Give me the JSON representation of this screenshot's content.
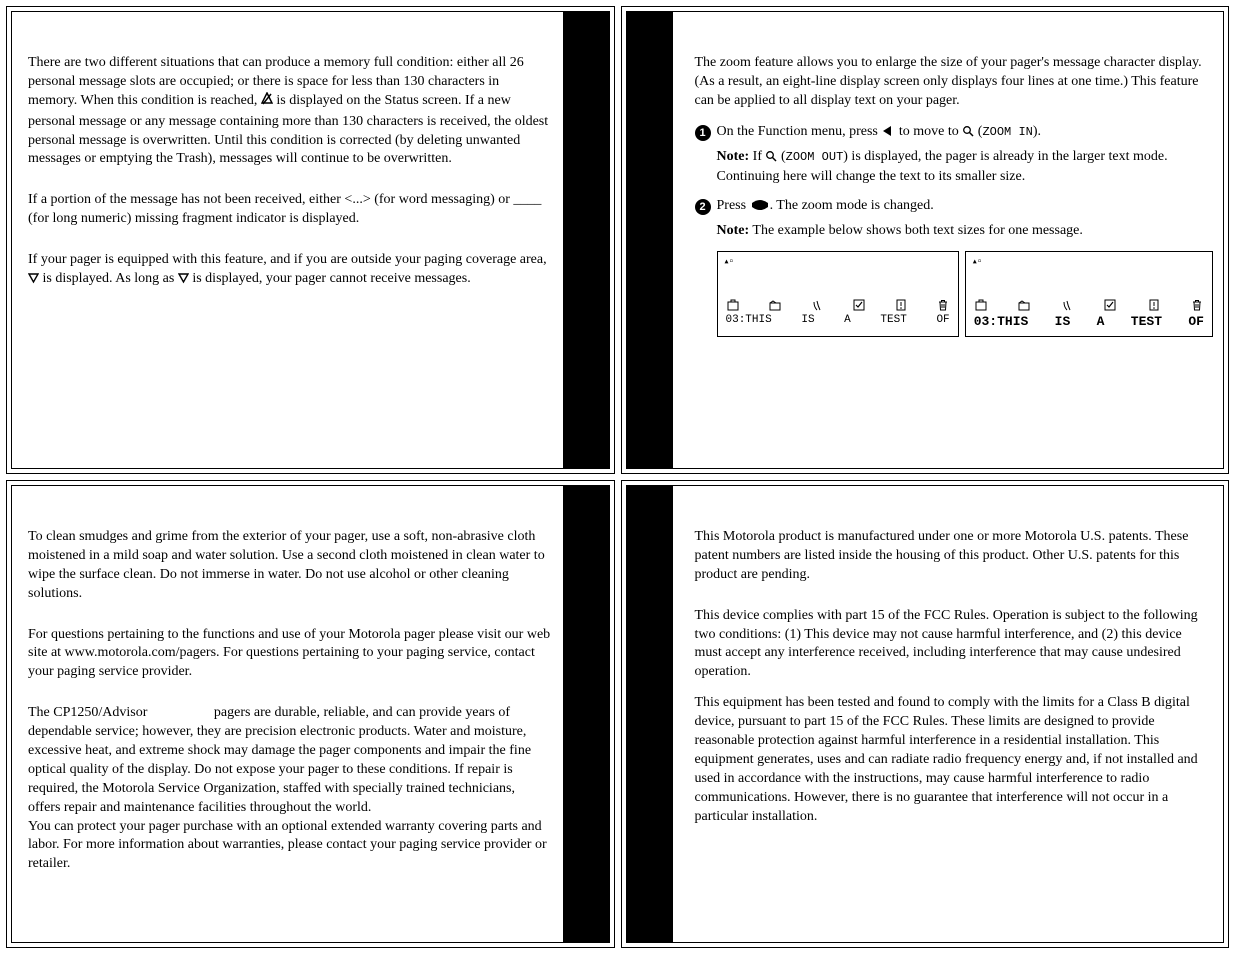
{
  "panel_top_left": {
    "para1": "There are two different situations that can produce a memory full condition: either all 26 personal message slots are occupied; or there is space for less than 130 characters in memory. When this condition is reached, ",
    "para1_after_icon": " is displayed on the Status screen. If a new personal message or any message containing more than 130 characters is received, the oldest personal message is overwritten. Until this condition is corrected (by deleting unwanted messages or emptying the Trash), messages will continue to be overwritten.",
    "para2": "If a portion of the message has not been received, either <...> (for word messaging) or ____ (for long numeric) missing fragment indicator is displayed.",
    "para3_a": "If your pager is equipped with this feature, and if you are outside your paging coverage area, ",
    "para3_b": " is displayed. As long as ",
    "para3_c": " is displayed, your pager cannot receive messages."
  },
  "panel_top_right": {
    "intro": "The zoom feature allows you to enlarge the size of your pager's message character display. (As a result, an eight-line display screen only displays four lines at one time.) This feature can be applied to all display text on your pager.",
    "step1_a": "On the Function menu, press ",
    "step1_b": " to move to ",
    "step1_c": " (",
    "step1_zoom_in": "ZOOM IN",
    "step1_d": ").",
    "note1_a": "If ",
    "note1_b": " (",
    "note1_zoom_out": "ZOOM OUT",
    "note1_c": ") is displayed, the pager is already in the larger text mode. Continuing here will change the text to its smaller size.",
    "note_label": "Note:",
    "step2_a": "Press ",
    "step2_b": ". The zoom mode is changed.",
    "note2": "The example below shows both text sizes for one message.",
    "display_small": {
      "line": [
        "03:THIS",
        "IS",
        "A",
        "TEST",
        "OF"
      ]
    },
    "display_large": {
      "line": [
        "03:THIS",
        "IS",
        "A",
        "TEST",
        "OF"
      ]
    }
  },
  "panel_bottom_left": {
    "para1": "To clean smudges and grime from the exterior of your pager, use a soft, non-abrasive cloth moistened in a mild soap and water solution. Use a second cloth moistened in clean water to wipe the surface clean. Do not immerse in water. Do not use alcohol or other cleaning solutions.",
    "para2": "For questions pertaining to the functions and use of your Motorola pager please visit our web site at www.motorola.com/pagers. For questions pertaining to your paging service, contact your paging service provider.",
    "para3": "The CP1250/Advisor                   pagers are durable, reliable, and can provide years of dependable service; however, they are precision electronic products. Water and moisture, excessive heat, and extreme shock may damage the pager components and impair the fine optical quality of the display. Do not expose your pager to these conditions. If repair is required, the Motorola Service Organization, staffed with specially trained technicians, offers repair and maintenance facilities throughout the world.",
    "para4": "You can protect your pager purchase with an optional extended warranty covering parts and labor. For more information about warranties, please contact your paging service provider or retailer."
  },
  "panel_bottom_right": {
    "para1": "This Motorola product is manufactured under one or more Motorola U.S. patents. These patent numbers are listed inside the housing of this product. Other U.S. patents for this product are pending.",
    "para2": "This device complies with part 15 of the FCC Rules. Operation is subject to the following two conditions: (1) This device may not cause harmful interference, and (2) this device must accept any interference received, including interference that may cause undesired operation.",
    "para3": "This equipment has been tested and found to comply with the limits for a Class B digital device, pursuant to part 15 of the FCC Rules. These limits are designed to provide reasonable protection against harmful interference in a residential installation. This equipment generates, uses and can radiate radio frequency energy and, if not installed and used in accordance with the instructions, may cause harmful interference to radio communications. However, there is no guarantee that interference will not occur in a particular installation."
  }
}
